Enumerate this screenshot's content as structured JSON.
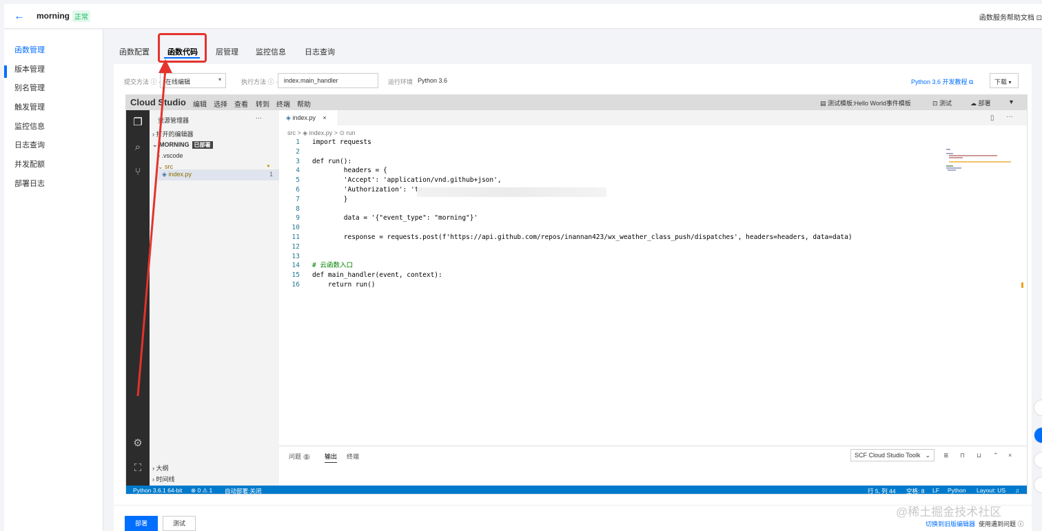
{
  "header": {
    "back_icon": "←",
    "function_name": "morning",
    "status": "正常",
    "help_doc": "函数服务帮助文档 ⊡"
  },
  "sidebar": {
    "items": [
      {
        "label": "函数管理",
        "active": true
      },
      {
        "label": "版本管理"
      },
      {
        "label": "别名管理"
      },
      {
        "label": "触发管理"
      },
      {
        "label": "监控信息"
      },
      {
        "label": "日志查询"
      },
      {
        "label": "并发配额"
      },
      {
        "label": "部署日志"
      }
    ]
  },
  "tabs": [
    {
      "label": "函数配置"
    },
    {
      "label": "函数代码",
      "active": true
    },
    {
      "label": "层管理"
    },
    {
      "label": "监控信息"
    },
    {
      "label": "日志查询"
    }
  ],
  "form": {
    "submit_method_label": "提交方法 ⓘ ·",
    "submit_method_value": "在线编辑",
    "handler_label": "执行方法 ⓘ ·",
    "handler_value": "index.main_handler",
    "runtime_label": "运行环境",
    "runtime_value": "Python 3.6",
    "dev_link": "Python 3.6 开发教程 ⧉",
    "download": "下载"
  },
  "ide": {
    "brand": "Cloud Studio",
    "menu": [
      "编辑",
      "选择",
      "查看",
      "转到",
      "终端",
      "帮助"
    ],
    "test_template": "测试模板:Hello World事件模板",
    "test_button": "测试",
    "deploy_button": "部署",
    "explorer": {
      "title": "资源管理器",
      "open_editors": "打开的编辑器",
      "folder": "MORNING",
      "deployed_badge": "已部署",
      "vscode": ".vscode",
      "src": "src",
      "file": "index.py",
      "file_count": "1",
      "outline": "大纲",
      "timeline": "时间线"
    },
    "editor_tab": "index.py",
    "breadcrumb": "src > ◈ index.py > ⊙ run",
    "code_lines": [
      {
        "n": "1",
        "text": "import requests"
      },
      {
        "n": "2",
        "text": ""
      },
      {
        "n": "3",
        "text": "def run():"
      },
      {
        "n": "4",
        "text": "        headers = {"
      },
      {
        "n": "5",
        "text": "        'Accept': 'application/vnd.github+json',"
      },
      {
        "n": "6",
        "text": "        'Authorization': 'to"
      },
      {
        "n": "7",
        "text": "        }"
      },
      {
        "n": "8",
        "text": ""
      },
      {
        "n": "9",
        "text": "        data = '{\"event_type\": \"morning\"}'"
      },
      {
        "n": "10",
        "text": ""
      },
      {
        "n": "11",
        "text": "        response = requests.post(f'https://api.github.com/repos/inannan423/wx_weather_class_push/dispatches', headers=headers, data=data)"
      },
      {
        "n": "12",
        "text": ""
      },
      {
        "n": "13",
        "text": ""
      },
      {
        "n": "14",
        "text": "# 云函数入口"
      },
      {
        "n": "15",
        "text": "def main_handler(event, context):"
      },
      {
        "n": "16",
        "text": "    return run()"
      }
    ],
    "panel": {
      "problems": "问题",
      "problems_count": "1",
      "output": "输出",
      "terminal": "终端",
      "select": "SCF Cloud Studio Toolk"
    },
    "status": {
      "python": "Python 3.6.1 64-bit",
      "errors": "⊗ 0 ⚠ 1",
      "autodeploy": "自动部署:关闭",
      "position": "行 5, 列 44",
      "spaces": "空格: 8",
      "eol": "LF",
      "lang": "Python",
      "layout": "Layout: US"
    }
  },
  "actions": {
    "deploy": "部署",
    "test": "测试",
    "switch_editor": "切换到旧版编辑器",
    "issues": "使用遇到问题 ⓘ"
  },
  "watermark": "@稀土掘金技术社区"
}
